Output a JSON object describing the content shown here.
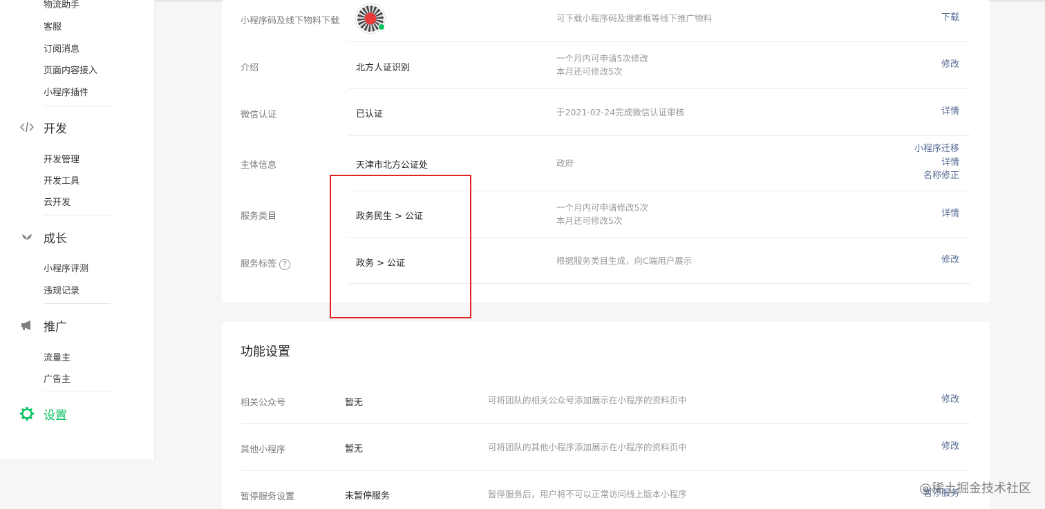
{
  "sidebar": {
    "top_items": [
      "物流助手",
      "客服",
      "订阅消息",
      "页面内容接入",
      "小程序插件"
    ],
    "groups": [
      {
        "label": "开发",
        "icon": "code-icon",
        "items": [
          "开发管理",
          "开发工具",
          "云开发"
        ]
      },
      {
        "label": "成长",
        "icon": "sprout-icon",
        "items": [
          "小程序评测",
          "违规记录"
        ]
      },
      {
        "label": "推广",
        "icon": "megaphone-icon",
        "items": [
          "流量主",
          "广告主"
        ]
      },
      {
        "label": "设置",
        "icon": "gear-icon",
        "items": []
      }
    ],
    "active_color": "#07c160"
  },
  "info": {
    "rows": [
      {
        "label": "小程序码及线下物料下载",
        "value": "",
        "desc1": "可下载小程序码及搜索框等线下推广物料",
        "desc2": "",
        "actions": [
          "下载"
        ]
      },
      {
        "label": "介绍",
        "value": "北方人证识别",
        "desc1": "一个月内可申请5次修改",
        "desc2": "本月还可修改5次",
        "actions": [
          "修改"
        ]
      },
      {
        "label": "微信认证",
        "value": "已认证",
        "desc1": "于2021-02-24完成微信认证审核",
        "desc2": "",
        "actions": [
          "详情"
        ]
      },
      {
        "label": "主体信息",
        "value": "天津市北方公证处",
        "desc1": "政府",
        "desc2": "",
        "actions": [
          "小程序迁移",
          "详情",
          "名称修正"
        ]
      },
      {
        "label": "服务类目",
        "value": "政务民生 > 公证",
        "desc1": "一个月内可申请修改5次",
        "desc2": "本月还可修改5次",
        "actions": [
          "详情"
        ]
      },
      {
        "label": "服务标签",
        "value": "政务 > 公证",
        "desc1": "根据服务类目生成，向C端用户展示",
        "desc2": "",
        "actions": [
          "修改"
        ]
      }
    ],
    "help_glyph": "?"
  },
  "func": {
    "title": "功能设置",
    "rows": [
      {
        "label": "相关公众号",
        "value": "暂无",
        "desc": "可将团队的相关公众号添加展示在小程序的资料页中",
        "action": "修改"
      },
      {
        "label": "其他小程序",
        "value": "暂无",
        "desc": "可将团队的其他小程序添加展示在小程序的资料页中",
        "action": "修改"
      },
      {
        "label": "暂停服务设置",
        "value": "未暂停服务",
        "desc": "暂停服务后，用户将不可以正常访问线上版本小程序",
        "action": "暂停服务"
      }
    ]
  },
  "colors": {
    "link": "#576b95",
    "highlight": "#e02424"
  },
  "watermark": "@稀土掘金技术社区"
}
